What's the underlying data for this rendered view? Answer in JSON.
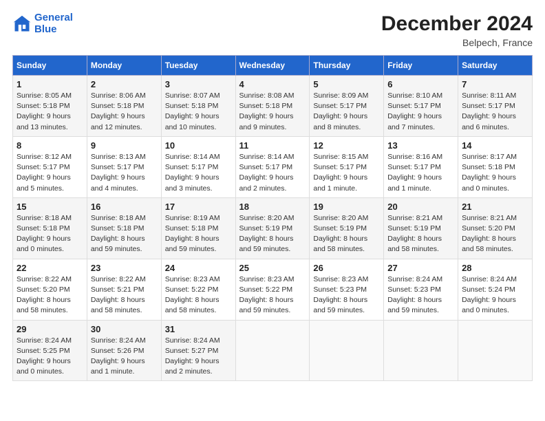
{
  "header": {
    "logo_line1": "General",
    "logo_line2": "Blue",
    "main_title": "December 2024",
    "subtitle": "Belpech, France"
  },
  "calendar": {
    "days_of_week": [
      "Sunday",
      "Monday",
      "Tuesday",
      "Wednesday",
      "Thursday",
      "Friday",
      "Saturday"
    ],
    "weeks": [
      [
        {
          "day": "1",
          "sunrise": "Sunrise: 8:05 AM",
          "sunset": "Sunset: 5:18 PM",
          "daylight": "Daylight: 9 hours and 13 minutes."
        },
        {
          "day": "2",
          "sunrise": "Sunrise: 8:06 AM",
          "sunset": "Sunset: 5:18 PM",
          "daylight": "Daylight: 9 hours and 12 minutes."
        },
        {
          "day": "3",
          "sunrise": "Sunrise: 8:07 AM",
          "sunset": "Sunset: 5:18 PM",
          "daylight": "Daylight: 9 hours and 10 minutes."
        },
        {
          "day": "4",
          "sunrise": "Sunrise: 8:08 AM",
          "sunset": "Sunset: 5:18 PM",
          "daylight": "Daylight: 9 hours and 9 minutes."
        },
        {
          "day": "5",
          "sunrise": "Sunrise: 8:09 AM",
          "sunset": "Sunset: 5:17 PM",
          "daylight": "Daylight: 9 hours and 8 minutes."
        },
        {
          "day": "6",
          "sunrise": "Sunrise: 8:10 AM",
          "sunset": "Sunset: 5:17 PM",
          "daylight": "Daylight: 9 hours and 7 minutes."
        },
        {
          "day": "7",
          "sunrise": "Sunrise: 8:11 AM",
          "sunset": "Sunset: 5:17 PM",
          "daylight": "Daylight: 9 hours and 6 minutes."
        }
      ],
      [
        {
          "day": "8",
          "sunrise": "Sunrise: 8:12 AM",
          "sunset": "Sunset: 5:17 PM",
          "daylight": "Daylight: 9 hours and 5 minutes."
        },
        {
          "day": "9",
          "sunrise": "Sunrise: 8:13 AM",
          "sunset": "Sunset: 5:17 PM",
          "daylight": "Daylight: 9 hours and 4 minutes."
        },
        {
          "day": "10",
          "sunrise": "Sunrise: 8:14 AM",
          "sunset": "Sunset: 5:17 PM",
          "daylight": "Daylight: 9 hours and 3 minutes."
        },
        {
          "day": "11",
          "sunrise": "Sunrise: 8:14 AM",
          "sunset": "Sunset: 5:17 PM",
          "daylight": "Daylight: 9 hours and 2 minutes."
        },
        {
          "day": "12",
          "sunrise": "Sunrise: 8:15 AM",
          "sunset": "Sunset: 5:17 PM",
          "daylight": "Daylight: 9 hours and 1 minute."
        },
        {
          "day": "13",
          "sunrise": "Sunrise: 8:16 AM",
          "sunset": "Sunset: 5:17 PM",
          "daylight": "Daylight: 9 hours and 1 minute."
        },
        {
          "day": "14",
          "sunrise": "Sunrise: 8:17 AM",
          "sunset": "Sunset: 5:18 PM",
          "daylight": "Daylight: 9 hours and 0 minutes."
        }
      ],
      [
        {
          "day": "15",
          "sunrise": "Sunrise: 8:18 AM",
          "sunset": "Sunset: 5:18 PM",
          "daylight": "Daylight: 9 hours and 0 minutes."
        },
        {
          "day": "16",
          "sunrise": "Sunrise: 8:18 AM",
          "sunset": "Sunset: 5:18 PM",
          "daylight": "Daylight: 8 hours and 59 minutes."
        },
        {
          "day": "17",
          "sunrise": "Sunrise: 8:19 AM",
          "sunset": "Sunset: 5:18 PM",
          "daylight": "Daylight: 8 hours and 59 minutes."
        },
        {
          "day": "18",
          "sunrise": "Sunrise: 8:20 AM",
          "sunset": "Sunset: 5:19 PM",
          "daylight": "Daylight: 8 hours and 59 minutes."
        },
        {
          "day": "19",
          "sunrise": "Sunrise: 8:20 AM",
          "sunset": "Sunset: 5:19 PM",
          "daylight": "Daylight: 8 hours and 58 minutes."
        },
        {
          "day": "20",
          "sunrise": "Sunrise: 8:21 AM",
          "sunset": "Sunset: 5:19 PM",
          "daylight": "Daylight: 8 hours and 58 minutes."
        },
        {
          "day": "21",
          "sunrise": "Sunrise: 8:21 AM",
          "sunset": "Sunset: 5:20 PM",
          "daylight": "Daylight: 8 hours and 58 minutes."
        }
      ],
      [
        {
          "day": "22",
          "sunrise": "Sunrise: 8:22 AM",
          "sunset": "Sunset: 5:20 PM",
          "daylight": "Daylight: 8 hours and 58 minutes."
        },
        {
          "day": "23",
          "sunrise": "Sunrise: 8:22 AM",
          "sunset": "Sunset: 5:21 PM",
          "daylight": "Daylight: 8 hours and 58 minutes."
        },
        {
          "day": "24",
          "sunrise": "Sunrise: 8:23 AM",
          "sunset": "Sunset: 5:22 PM",
          "daylight": "Daylight: 8 hours and 58 minutes."
        },
        {
          "day": "25",
          "sunrise": "Sunrise: 8:23 AM",
          "sunset": "Sunset: 5:22 PM",
          "daylight": "Daylight: 8 hours and 59 minutes."
        },
        {
          "day": "26",
          "sunrise": "Sunrise: 8:23 AM",
          "sunset": "Sunset: 5:23 PM",
          "daylight": "Daylight: 8 hours and 59 minutes."
        },
        {
          "day": "27",
          "sunrise": "Sunrise: 8:24 AM",
          "sunset": "Sunset: 5:23 PM",
          "daylight": "Daylight: 8 hours and 59 minutes."
        },
        {
          "day": "28",
          "sunrise": "Sunrise: 8:24 AM",
          "sunset": "Sunset: 5:24 PM",
          "daylight": "Daylight: 9 hours and 0 minutes."
        }
      ],
      [
        {
          "day": "29",
          "sunrise": "Sunrise: 8:24 AM",
          "sunset": "Sunset: 5:25 PM",
          "daylight": "Daylight: 9 hours and 0 minutes."
        },
        {
          "day": "30",
          "sunrise": "Sunrise: 8:24 AM",
          "sunset": "Sunset: 5:26 PM",
          "daylight": "Daylight: 9 hours and 1 minute."
        },
        {
          "day": "31",
          "sunrise": "Sunrise: 8:24 AM",
          "sunset": "Sunset: 5:27 PM",
          "daylight": "Daylight: 9 hours and 2 minutes."
        },
        null,
        null,
        null,
        null
      ]
    ]
  }
}
